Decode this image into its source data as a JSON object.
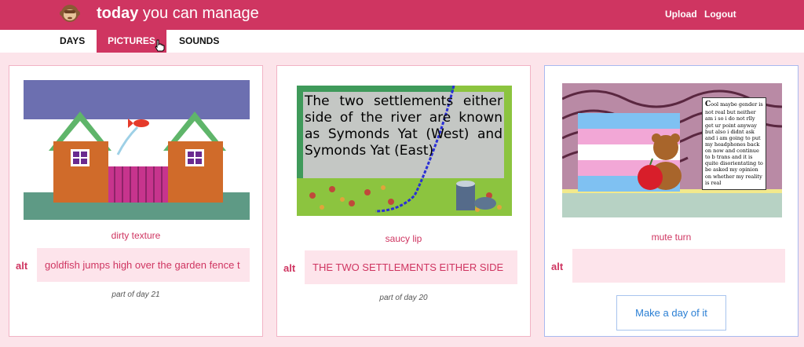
{
  "app": {
    "brand_bold": "today",
    "brand_rest": "you can manage",
    "upload_label": "Upload",
    "logout_label": "Logout",
    "colors": {
      "accent": "#cf3561",
      "page_bg": "#fce4ea",
      "link_blue": "#2a7fd4"
    },
    "logo_icon": "monkey-face-icon"
  },
  "tabs": [
    {
      "label": "DAYS",
      "active": false
    },
    {
      "label": "PICTURES",
      "active": true
    },
    {
      "label": "SOUNDS",
      "active": false
    }
  ],
  "cards": [
    {
      "caption": "dirty texture",
      "alt_label": "alt",
      "alt_value": "goldfish jumps high over the garden fence t",
      "part_of": "part of day 21"
    },
    {
      "caption": "saucy lip",
      "alt_label": "alt",
      "alt_value": "THE TWO SETTLEMENTS EITHER SIDE",
      "part_of": "part of day 20",
      "image_text": "The two settlements either side of the river are known as Symonds Yat (West) and Symonds Yat (East)"
    },
    {
      "caption": "mute turn",
      "alt_label": "alt",
      "alt_value": "",
      "button_label": "Make a day of it",
      "image_text": "Cool maybe gender is not real but neither am i so i do not rlly get ur point anyway but also i didnt ask and i am going to put my headphones back on now and continue to b trans and it is quite disorientating to be asked my opinion on whether my reality is real"
    }
  ]
}
